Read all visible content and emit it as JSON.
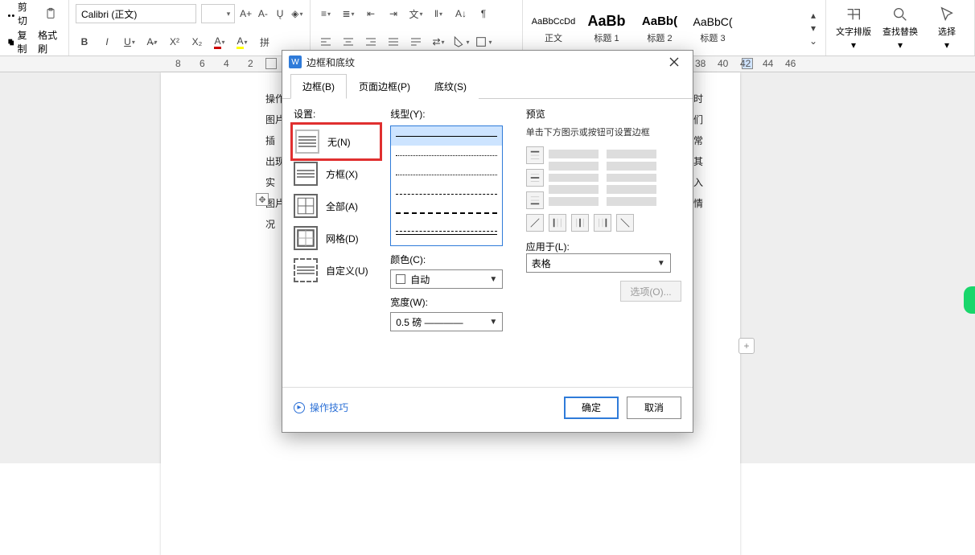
{
  "ribbon": {
    "clipboard": {
      "cut": "剪切",
      "copy": "复制",
      "format_painter": "格式刷"
    },
    "font_name": "Calibri (正文)",
    "font_size": "",
    "styles": [
      {
        "sample": "AaBbCcDd",
        "label": "正文",
        "weight": "normal",
        "size": "11px"
      },
      {
        "sample": "AaBb",
        "label": "标题 1",
        "weight": "bold",
        "size": "18px"
      },
      {
        "sample": "AaBb(",
        "label": "标题 2",
        "weight": "bold",
        "size": "15px"
      },
      {
        "sample": "AaBbC(",
        "label": "标题 3",
        "weight": "normal",
        "size": "14px"
      }
    ],
    "text_layout": "文字排版",
    "find_replace": "查找替换",
    "select": "选择"
  },
  "ruler_marks": [
    "8",
    "6",
    "4",
    "2"
  ],
  "ruler_marks_right": [
    "38",
    "40",
    "42",
    "44",
    "46"
  ],
  "doc_left": [
    "操作",
    "图片",
    "插",
    "出现",
    "实",
    "图片",
    "况"
  ],
  "doc_right": [
    "时",
    "们",
    "常",
    "其",
    "入",
    "情"
  ],
  "dialog": {
    "title": "边框和底纹",
    "tabs": {
      "border": "边框(B)",
      "page_border": "页面边框(P)",
      "shading": "底纹(S)"
    },
    "settings_label": "设置:",
    "settings": {
      "none": "无(N)",
      "box": "方框(X)",
      "all": "全部(A)",
      "grid": "网格(D)",
      "custom": "自定义(U)"
    },
    "line_style_label": "线型(Y):",
    "color_label": "颜色(C):",
    "color_value": "自动",
    "width_label": "宽度(W):",
    "width_value": "0.5  磅 ————",
    "preview_label": "预览",
    "preview_hint": "单击下方图示或按钮可设置边框",
    "apply_label": "应用于(L):",
    "apply_value": "表格",
    "options_btn": "选项(O)...",
    "tips": "操作技巧",
    "ok": "确定",
    "cancel": "取消"
  }
}
